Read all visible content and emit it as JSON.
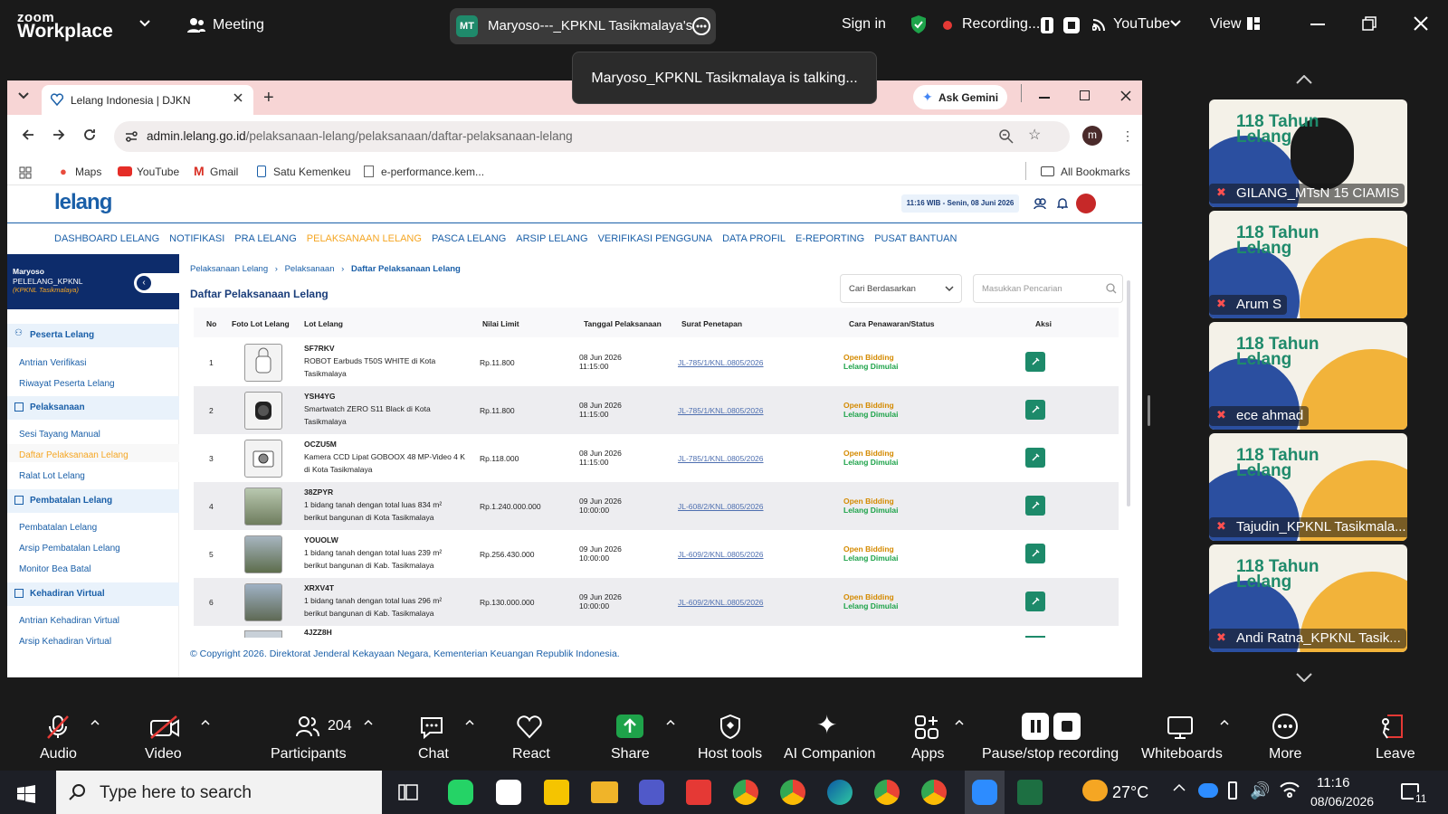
{
  "zoom": {
    "logo_line1": "zoom",
    "logo_line2": "Workplace",
    "meeting_label": "Meeting",
    "avatar_initials": "MT",
    "meeting_title": "Maryoso---_KPKNL Tasikmalaya's",
    "sign_in": "Sign in",
    "recording": "Recording...",
    "youtube": "YouTube",
    "view": "View",
    "talking": "Maryoso_KPKNL Tasikmalaya is talking..."
  },
  "browser": {
    "tab_title": "Lelang Indonesia | DJKN",
    "url_host": "admin.lelang.go.id",
    "url_path": "/pelaksanaan-lelang/pelaksanaan/daftar-pelaksanaan-lelang",
    "ask_gemini": "Ask Gemini",
    "profile_initial": "m",
    "bookmarks": [
      "Maps",
      "YouTube",
      "Gmail",
      "Satu Kemenkeu",
      "e-performance.kem..."
    ],
    "all_bookmarks": "All Bookmarks"
  },
  "site": {
    "logo": "lelang",
    "clock": "11:16 WIB - Senin, 08 Juni 2026",
    "menu": [
      "DASHBOARD LELANG",
      "NOTIFIKASI",
      "PRA LELANG",
      "PELAKSANAAN LELANG",
      "PASCA LELANG",
      "ARSIP LELANG",
      "VERIFIKASI PENGGUNA",
      "DATA PROFIL",
      "E-REPORTING",
      "PUSAT BANTUAN"
    ],
    "active_menu_color": "#f5a623",
    "user_name": "Maryoso",
    "user_role": "PELELANG_KPKNL",
    "user_office": "(KPKNL Tasikmalaya)",
    "sidebar": {
      "sec1": "Peserta Lelang",
      "sec1_items": [
        "Antrian Verifikasi",
        "Riwayat Peserta Lelang"
      ],
      "sec2": "Pelaksanaan",
      "sec2_items": [
        "Sesi Tayang Manual",
        "Daftar Pelaksanaan Lelang",
        "Ralat Lot Lelang"
      ],
      "sec3": "Pembatalan Lelang",
      "sec3_items": [
        "Pembatalan Lelang",
        "Arsip Pembatalan Lelang",
        "Monitor Bea Batal"
      ],
      "sec4": "Kehadiran Virtual",
      "sec4_items": [
        "Antrian Kehadiran Virtual",
        "Arsip Kehadiran Virtual"
      ]
    },
    "breadcrumb": [
      "Pelaksanaan Lelang",
      "Pelaksanaan",
      "Daftar Pelaksanaan Lelang"
    ],
    "page_title": "Daftar Pelaksanaan Lelang",
    "filter_select": "Cari Berdasarkan",
    "search_placeholder": "Masukkan Pencarian",
    "columns": [
      "No",
      "Foto Lot Lelang",
      "Lot Lelang",
      "Nilai Limit",
      "Tanggal Pelaksanaan",
      "Surat Penetapan",
      "Cara Penawaran/Status",
      "Aksi"
    ],
    "rows": [
      {
        "no": "1",
        "code": "SF7RKV",
        "desc1": "ROBOT Earbuds T50S WHITE di Kota",
        "desc2": "Tasikmalaya",
        "limit": "Rp.11.800",
        "date": "08 Jun 2026",
        "time": "11:15:00",
        "letter": "JL-785/1/KNL.0805/2026",
        "status1": "Open Bidding",
        "status2": "Lelang Dimulai"
      },
      {
        "no": "2",
        "code": "YSH4YG",
        "desc1": "Smartwatch ZERO S11 Black di Kota",
        "desc2": "Tasikmalaya",
        "limit": "Rp.11.800",
        "date": "08 Jun 2026",
        "time": "11:15:00",
        "letter": "JL-785/1/KNL.0805/2026",
        "status1": "Open Bidding",
        "status2": "Lelang Dimulai"
      },
      {
        "no": "3",
        "code": "OCZU5M",
        "desc1": "Kamera CCD Lipat GOBOOX 48 MP-Video 4 K",
        "desc2": "di Kota Tasikmalaya",
        "limit": "Rp.118.000",
        "date": "08 Jun 2026",
        "time": "11:15:00",
        "letter": "JL-785/1/KNL.0805/2026",
        "status1": "Open Bidding",
        "status2": "Lelang Dimulai"
      },
      {
        "no": "4",
        "code": "38ZPYR",
        "desc1": "1 bidang tanah dengan total luas 834 m²",
        "desc2": "berikut bangunan di Kota Tasikmalaya",
        "limit": "Rp.1.240.000.000",
        "date": "09 Jun 2026",
        "time": "10:00:00",
        "letter": "JL-608/2/KNL.0805/2026",
        "status1": "Open Bidding",
        "status2": "Lelang Dimulai"
      },
      {
        "no": "5",
        "code": "YOUOLW",
        "desc1": "1 bidang tanah dengan total luas 239 m²",
        "desc2": "berikut bangunan di Kab. Tasikmalaya",
        "limit": "Rp.256.430.000",
        "date": "09 Jun 2026",
        "time": "10:00:00",
        "letter": "JL-609/2/KNL.0805/2026",
        "status1": "Open Bidding",
        "status2": "Lelang Dimulai"
      },
      {
        "no": "6",
        "code": "XRXV4T",
        "desc1": "1 bidang tanah dengan total luas 296 m²",
        "desc2": "berikut bangunan di Kab. Tasikmalaya",
        "limit": "Rp.130.000.000",
        "date": "09 Jun 2026",
        "time": "10:00:00",
        "letter": "JL-609/2/KNL.0805/2026",
        "status1": "Open Bidding",
        "status2": "Lelang Dimulai"
      }
    ],
    "row7_code": "4JZZ8H",
    "copyright": "© Copyright 2026. Direktorat Jenderal Kekayaan Negara, Kementerian Keuangan Republik Indonesia."
  },
  "participants": {
    "banner_line1": "118 Tahun",
    "banner_line2": "Lelang",
    "names": [
      "GILANG_MTsN 15 CIAMIS",
      "Arum S",
      "ece ahmad",
      "Tajudin_KPKNL Tasikmala...",
      "Andi Ratna_KPKNL Tasik..."
    ]
  },
  "controls": {
    "audio": "Audio",
    "video": "Video",
    "participants": "Participants",
    "participants_count": "204",
    "chat": "Chat",
    "react": "React",
    "share": "Share",
    "host_tools": "Host tools",
    "ai_companion": "AI Companion",
    "apps": "Apps",
    "pause_stop": "Pause/stop recording",
    "whiteboards": "Whiteboards",
    "more": "More",
    "leave": "Leave"
  },
  "taskbar": {
    "search_placeholder": "Type here to search",
    "temperature": "27°C",
    "time": "11:16",
    "date": "08/06/2026",
    "notifications": "11"
  }
}
